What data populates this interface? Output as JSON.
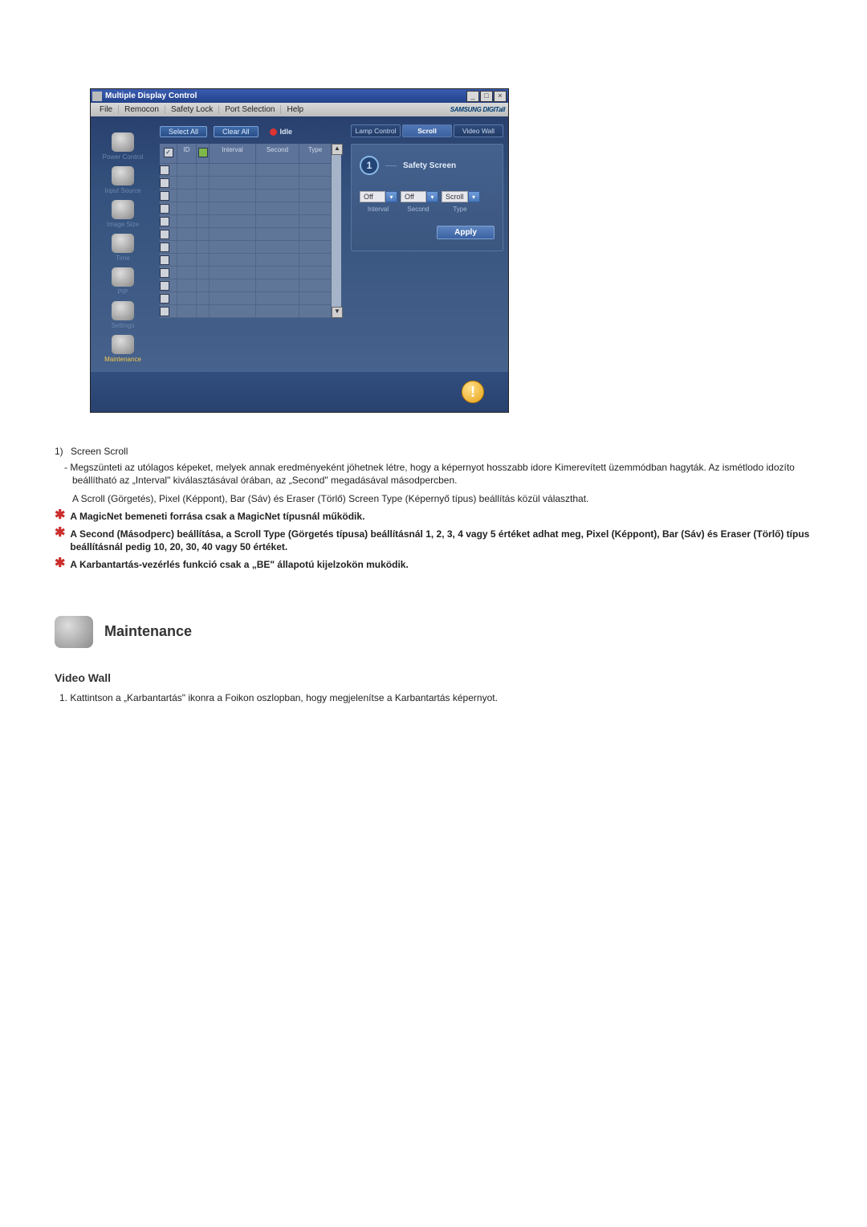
{
  "app": {
    "title": "Multiple Display Control",
    "brand": "SAMSUNG DIGITall",
    "menu": [
      "File",
      "Remocon",
      "Safety Lock",
      "Port Selection",
      "Help"
    ],
    "toolbar": {
      "select_all": "Select All",
      "clear_all": "Clear All",
      "status": "Idle"
    },
    "sidebar": [
      {
        "label": "Power Control"
      },
      {
        "label": "Input Source"
      },
      {
        "label": "Image Size"
      },
      {
        "label": "Time"
      },
      {
        "label": "PIP"
      },
      {
        "label": "Settings"
      },
      {
        "label": "Maintenance",
        "active": true
      }
    ],
    "grid_headers": {
      "chk": "",
      "id": "ID",
      "lamp": "",
      "interval": "Interval",
      "second": "Second",
      "type": "Type"
    },
    "right_panel": {
      "tabs": [
        {
          "label": "Lamp Control"
        },
        {
          "label": "Scroll",
          "active": true
        },
        {
          "label": "Video Wall"
        }
      ],
      "callout_num": "1",
      "title": "Safety Screen",
      "dropdowns": [
        {
          "value": "Off",
          "label": "Interval"
        },
        {
          "value": "Off",
          "label": "Second"
        },
        {
          "value": "Scroll",
          "label": "Type"
        }
      ],
      "apply": "Apply"
    }
  },
  "doc": {
    "item1_num": "1)",
    "item1_title": "Screen Scroll",
    "item1_dash": "- Megszünteti az utólagos képeket, melyek annak eredményeként jöhetnek létre, hogy a képernyot hosszabb idore Kimerevített üzemmódban hagyták. Az ismétlodo idozíto beállítható az „Interval\" kiválasztásával órában, az „Second\" megadásával másodpercben.",
    "item1_plain": "A Scroll (Görgetés), Pixel (Képpont), Bar (Sáv) és Eraser (Törlő) Screen Type (Képernyő típus) beállítás közül választhat.",
    "note1": "A MagicNet bemeneti forrása csak a MagicNet típusnál működik.",
    "note2": "A Second (Másodperc) beállítása, a Scroll Type (Görgetés típusa) beállításnál 1, 2, 3, 4 vagy 5 értéket adhat meg, Pixel (Képpont), Bar (Sáv) és Eraser (Törlő) típus beállításnál pedig 10, 20, 30, 40 vagy 50 értéket.",
    "note3": "A Karbantartás-vezérlés funkció csak a „BE\" állapotú kijelzokön muködik.",
    "section_title": "Maintenance",
    "subsection_title": "Video Wall",
    "step1": "1. Kattintson a „Karbantartás\" ikonra a Foikon oszlopban, hogy megjelenítse a Karbantartás képernyot."
  }
}
